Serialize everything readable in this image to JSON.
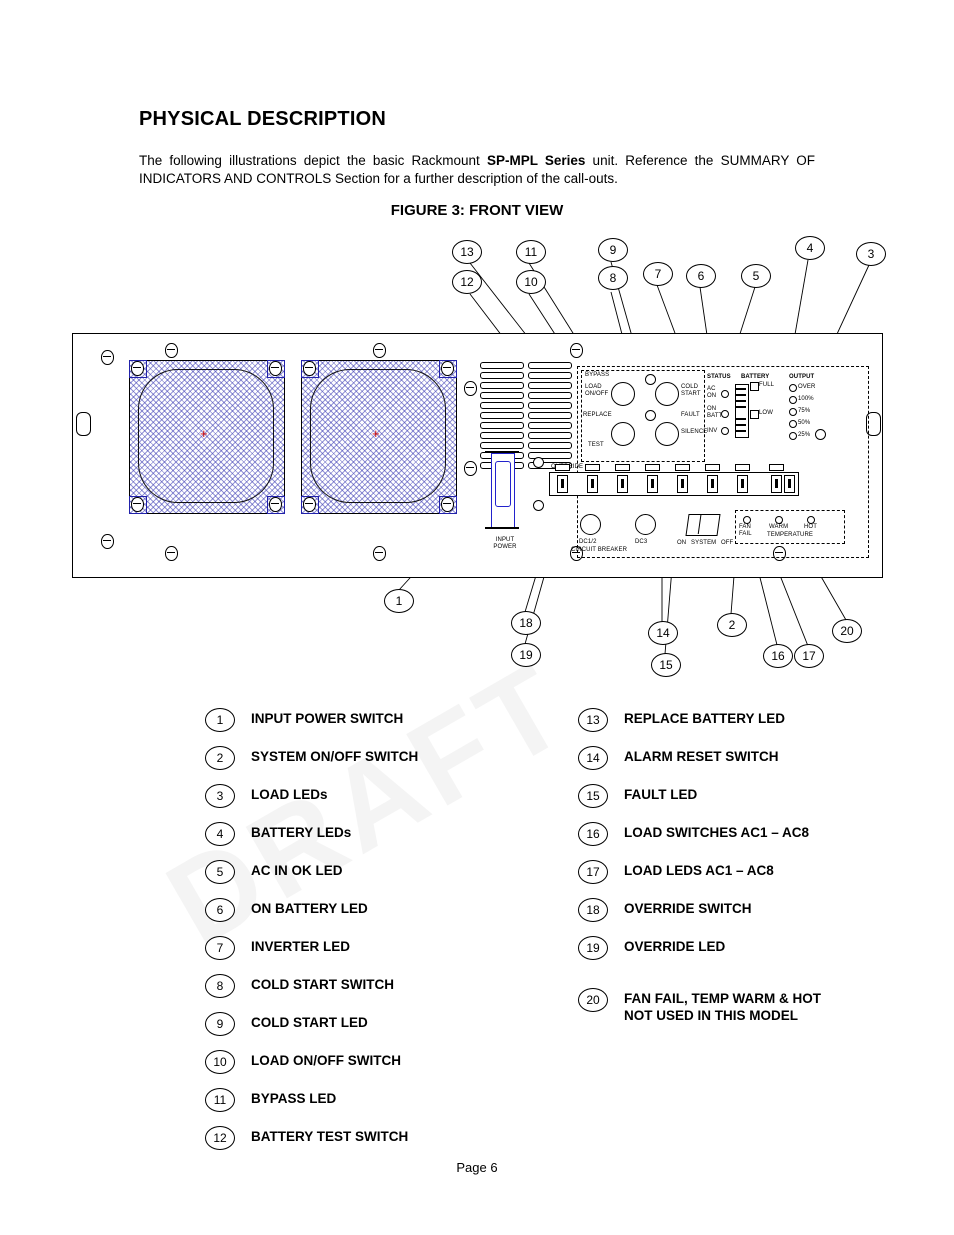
{
  "document": {
    "heading": "PHYSICAL DESCRIPTION",
    "intro_part1": "The following illustrations depict the basic Rackmount ",
    "intro_bold": "SP-MPL Series",
    "intro_part2": " unit.   Reference the SUMMARY OF INDICATORS AND CONTROLS Section for a further description of the call-outs.",
    "figure_title": "FIGURE 3: FRONT VIEW",
    "page_label": "Page 6",
    "watermark": "DRAFT"
  },
  "callouts": [
    {
      "n": "13"
    },
    {
      "n": "11"
    },
    {
      "n": "9"
    },
    {
      "n": "4"
    },
    {
      "n": "3"
    },
    {
      "n": "12"
    },
    {
      "n": "10"
    },
    {
      "n": "8"
    },
    {
      "n": "7"
    },
    {
      "n": "6"
    },
    {
      "n": "5"
    },
    {
      "n": "1"
    },
    {
      "n": "18"
    },
    {
      "n": "19"
    },
    {
      "n": "14"
    },
    {
      "n": "15"
    },
    {
      "n": "2"
    },
    {
      "n": "16"
    },
    {
      "n": "17"
    },
    {
      "n": "20"
    }
  ],
  "panel_labels": {
    "bypass": "BYPASS",
    "load_on_off": "LOAD\nON/OFF",
    "cold_start": "COLD\nSTART",
    "replace": "REPLACE",
    "fault": "FAULT",
    "test": "TEST",
    "silence": "SILENCE",
    "status": "STATUS",
    "battery": "BATTERY",
    "output": "OUTPUT",
    "ac_on": "AC\nON",
    "on_batt": "ON\nBATT",
    "inv": "INV",
    "full": "FULL",
    "low": "LOW",
    "over": "OVER",
    "p100": "100%",
    "p75": "75%",
    "p50": "50%",
    "p25": "25%",
    "input_power": "INPUT\nPOWER",
    "dc12": "DC1/2",
    "dc3": "DC3",
    "circuit_breaker": "CIRCUIT BREAKER",
    "on": "ON",
    "system": "SYSTEM",
    "off": "OFF",
    "fan_fail": "FAN\nFAIL",
    "warm": "WARM",
    "hot": "HOT",
    "temperature": "TEMPERATURE",
    "override": "OVERRIDE"
  },
  "legend": {
    "left": [
      {
        "num": "1",
        "label": "INPUT POWER SWITCH"
      },
      {
        "num": "2",
        "label": "SYSTEM ON/OFF SWITCH"
      },
      {
        "num": "3",
        "label": "LOAD LEDs"
      },
      {
        "num": "4",
        "label": "BATTERY LEDs"
      },
      {
        "num": "5",
        "label": "AC IN OK LED"
      },
      {
        "num": "6",
        "label": "ON BATTERY LED"
      },
      {
        "num": "7",
        "label": "INVERTER LED"
      },
      {
        "num": "8",
        "label": "COLD START SWITCH"
      },
      {
        "num": "9",
        "label": "COLD START LED"
      },
      {
        "num": "10",
        "label": "LOAD ON/OFF SWITCH"
      },
      {
        "num": "11",
        "label": "BYPASS LED"
      },
      {
        "num": "12",
        "label": "BATTERY TEST SWITCH"
      }
    ],
    "right": [
      {
        "num": "13",
        "label": "REPLACE BATTERY LED",
        "label2": ""
      },
      {
        "num": "14",
        "label": "ALARM RESET SWITCH",
        "label2": ""
      },
      {
        "num": "15",
        "label": "FAULT LED",
        "label2": ""
      },
      {
        "num": "16",
        "label": "LOAD SWITCHES AC1 – AC8",
        "label2": ""
      },
      {
        "num": "17",
        "label": "LOAD LEDS AC1 – AC8",
        "label2": ""
      },
      {
        "num": "18",
        "label": "OVERRIDE SWITCH",
        "label2": ""
      },
      {
        "num": "19",
        "label": "OVERRIDE LED",
        "label2": ""
      },
      {
        "num": "20",
        "label": "FAN FAIL, TEMP WARM & HOT",
        "label2": "NOT USED IN THIS MODEL"
      }
    ]
  }
}
